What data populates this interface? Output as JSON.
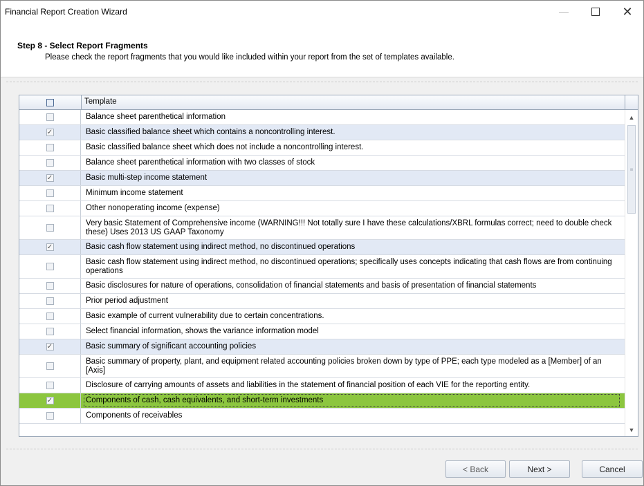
{
  "window": {
    "title": "Financial Report Creation Wizard",
    "minimize_glyph": "—",
    "close_glyph": "✕"
  },
  "header": {
    "step_title": "Step 8 - Select Report Fragments",
    "step_description": "Please check the report fragments that you would like included within your report from the set of templates available."
  },
  "grid": {
    "column_header": "Template",
    "rows": [
      {
        "label": "Balance sheet parenthetical information",
        "checked": false
      },
      {
        "label": "Basic classified balance sheet which contains a noncontrolling interest.",
        "checked": true
      },
      {
        "label": "Basic classified balance sheet which does not include a noncontrolling interest.",
        "checked": false
      },
      {
        "label": "Balance sheet parenthetical information with two classes of stock",
        "checked": false
      },
      {
        "label": "Basic multi-step income statement",
        "checked": true
      },
      {
        "label": "Minimum income statement",
        "checked": false
      },
      {
        "label": "Other nonoperating income (expense)",
        "checked": false
      },
      {
        "label": "Very basic Statement of Comprehensive income (WARNING!!! Not totally sure I have these calculations/XBRL formulas correct; need to double check these) Uses 2013 US GAAP Taxonomy",
        "checked": false,
        "tall": true
      },
      {
        "label": "Basic cash flow statement using indirect method, no discontinued operations",
        "checked": true
      },
      {
        "label": "Basic cash flow statement using indirect method, no discontinued operations; specifically uses concepts indicating that cash flows are from continuing operations",
        "checked": false,
        "tall": true
      },
      {
        "label": "Basic disclosures for nature of operations, consolidation of financial statements and basis of presentation of financial statements",
        "checked": false
      },
      {
        "label": "Prior period adjustment",
        "checked": false
      },
      {
        "label": "Basic example of current vulnerability due to certain concentrations.",
        "checked": false
      },
      {
        "label": "Select financial information, shows the variance information model",
        "checked": false
      },
      {
        "label": "Basic summary of significant accounting policies",
        "checked": true
      },
      {
        "label": "Basic summary of property, plant, and equipment related accounting policies broken down by type of PPE; each type modeled as a [Member] of an [Axis]",
        "checked": false,
        "tall": true
      },
      {
        "label": "Disclosure of carrying amounts of assets and liabilities in the statement of financial position of each VIE for the reporting entity.",
        "checked": false
      },
      {
        "label": "Components of cash, cash equivalents, and short-term investments",
        "checked": true,
        "selected": true
      },
      {
        "label": "Components of receivables",
        "checked": false
      }
    ]
  },
  "buttons": {
    "back": "< Back",
    "next": "Next >",
    "cancel": "Cancel"
  },
  "colors": {
    "selected_row": "#8cc63f",
    "checked_row": "#e2e9f5"
  }
}
